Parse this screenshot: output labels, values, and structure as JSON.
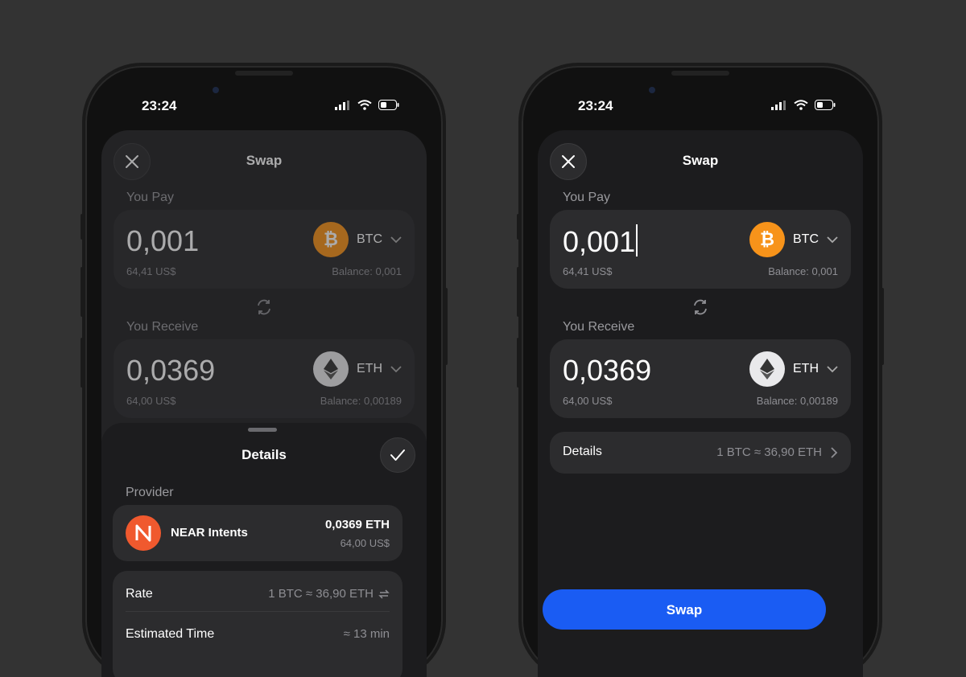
{
  "status": {
    "time": "23:24"
  },
  "swap": {
    "title": "Swap",
    "you_pay_label": "You Pay",
    "you_receive_label": "You Receive",
    "pay": {
      "amount": "0,001",
      "usd": "64,41 US$",
      "token": "BTC",
      "balance": "Balance: 0,001"
    },
    "receive": {
      "amount": "0,0369",
      "usd": "64,00 US$",
      "token": "ETH",
      "balance": "Balance: 0,00189"
    }
  },
  "details_sheet": {
    "title": "Details",
    "provider_label": "Provider",
    "provider": {
      "name": "NEAR Intents",
      "amount": "0,0369 ETH",
      "usd": "64,00 US$"
    },
    "rate_label": "Rate",
    "rate_value": "1 BTC ≈ 36,90 ETH",
    "time_label": "Estimated Time",
    "time_value": "≈ 13 min"
  },
  "details_row": {
    "label": "Details",
    "value": "1 BTC ≈ 36,90 ETH"
  },
  "swap_button": "Swap",
  "colors": {
    "background": "#333333",
    "btc": "#f7931a",
    "near": "#f0592e",
    "primary_button": "#1a5cf3"
  },
  "icons": [
    "close-icon",
    "swap-arrows-icon",
    "chevron-down-icon",
    "chevron-right-icon",
    "checkmark-icon",
    "refresh-icon",
    "btc-icon",
    "eth-icon",
    "near-icon",
    "wifi-icon",
    "signal-icon",
    "battery-icon"
  ]
}
